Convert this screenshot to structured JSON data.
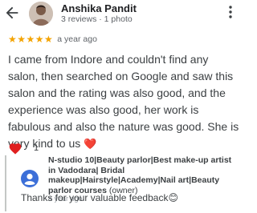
{
  "reviewer": {
    "name": "Anshika Pandit",
    "meta": "3 reviews · 1 photo"
  },
  "rating": {
    "stars": "★★★★★",
    "time": "a year ago"
  },
  "review_text": "I came from Indore and couldn't find any salon, then searched on Google and saw this salon and the rating was also good, and the experience was also good, her work is fabulous and also the nature was good. She is very kind to us",
  "review_emoji": "❤️",
  "likes": {
    "count": "1"
  },
  "owner": {
    "name": "N-studio 10|Beauty parlor|Best make-up artist in Vadodara| Bridal makeup|Hairstyle|Academy|Nail art|Beauty parlor courses",
    "label": "(owner)",
    "time": "a year ago",
    "reply": "Thanks for your valuable feedback😊"
  },
  "colors": {
    "star": "#f4a300",
    "heart": "#e02020",
    "owner_avatar": "#3c6fd8"
  }
}
